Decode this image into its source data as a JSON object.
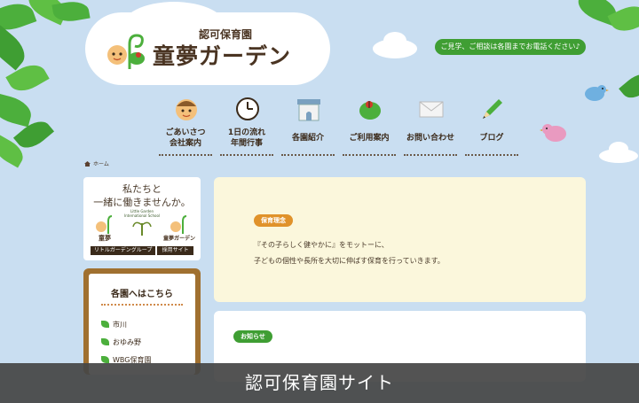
{
  "header": {
    "logo_sub": "認可保育園",
    "logo_main": "童夢ガーデン",
    "contact": "ご見学、ご相談は各園までお電話ください♪"
  },
  "nav": [
    {
      "label": "ごあいさつ\n会社案内",
      "icon": "child-face-icon"
    },
    {
      "label": "1日の流れ\n年間行事",
      "icon": "clock-icon"
    },
    {
      "label": "各園紹介",
      "icon": "building-icon"
    },
    {
      "label": "ご利用案内",
      "icon": "leaf-ladybug-icon"
    },
    {
      "label": "お問い合わせ",
      "icon": "envelope-icon"
    },
    {
      "label": "ブログ",
      "icon": "pencil-icon"
    }
  ],
  "breadcrumb": {
    "home": "ホーム"
  },
  "recruit": {
    "title_line1": "私たちと",
    "title_line2": "一緒に働きませんか。",
    "logo_left": "童夢",
    "logo_center": "Little Garden International School",
    "logo_right": "童夢ガーデン",
    "bar_left": "リトルガーデングループ",
    "bar_right": "採用サイト"
  },
  "shops": {
    "title": "各園へはこちら",
    "items": [
      "市川",
      "おゆみ野",
      "WBG保育園"
    ]
  },
  "policy": {
    "tag": "保育理念",
    "line1": "『その子らしく健やかに』をモットーに、",
    "line2": "子どもの個性や長所を大切に伸ばす保育を行っていきます。"
  },
  "news": {
    "tag": "お知らせ"
  },
  "footer": {
    "caption": "認可保育園サイト"
  },
  "colors": {
    "sky": "#c9def1",
    "green": "#3f9e33",
    "orange": "#e0922a",
    "brown": "#a07030"
  }
}
